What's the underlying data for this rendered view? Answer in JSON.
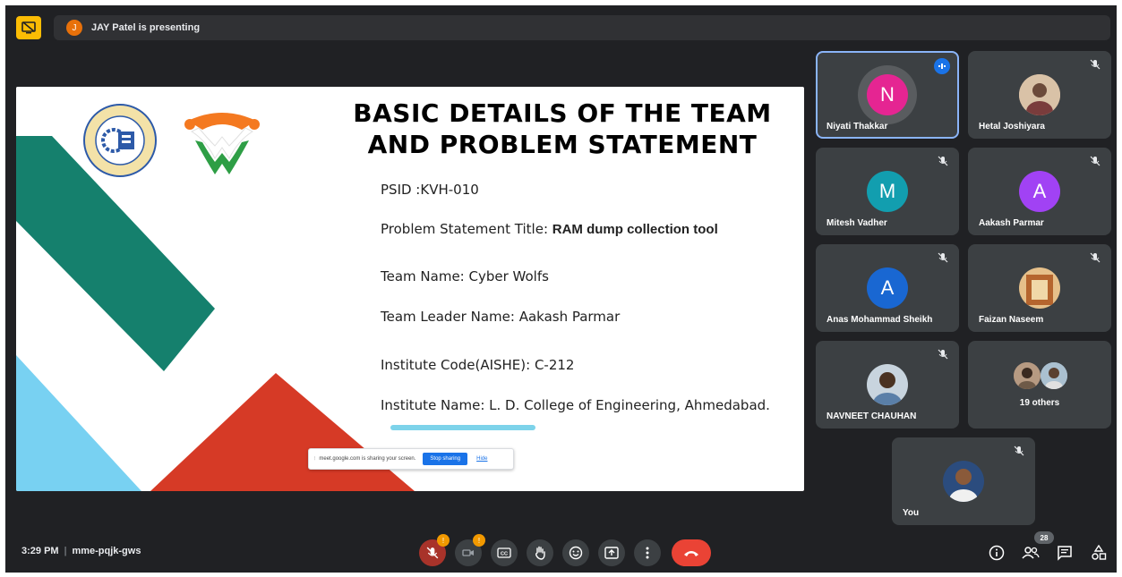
{
  "topbar": {
    "presenter_initial": "J",
    "presenting_text": "JAY Patel is presenting",
    "present_icon": "screen-share-off-icon"
  },
  "slide": {
    "title_line1": "BASIC DETAILS OF THE TEAM",
    "title_line2": "AND PROBLEM STATEMENT",
    "psid": "PSID :KVH-010",
    "problem_label": "Problem Statement Title: ",
    "problem_value": "RAM dump collection tool",
    "team_name": "Team Name: Cyber Wolfs",
    "team_leader": "Team Leader Name:  Aakash Parmar",
    "institute_code": "Institute Code(AISHE): C-212",
    "institute_name": "Institute Name:  L. D. College of Engineering, Ahmedabad.",
    "logo1_text": "L.D. COLLEGE OF ENGINEERING AHMEDABAD",
    "logo2_name": "sih-logo"
  },
  "share_bar": {
    "message": "meet.google.com is sharing your screen.",
    "stop_label": "Stop sharing",
    "hide_label": "Hide"
  },
  "participants": [
    {
      "name": "Niyati Thakkar",
      "initial": "N",
      "color": "#e52592",
      "speaking": true
    },
    {
      "name": "Hetal Joshiyara",
      "initial": "",
      "color": "#c9a48a",
      "muted": true
    },
    {
      "name": "Mitesh Vadher",
      "initial": "M",
      "color": "#129eaf",
      "muted": true
    },
    {
      "name": "Aakash Parmar",
      "initial": "A",
      "color": "#a142f4",
      "muted": true
    },
    {
      "name": "Anas Mohammad Sheikh",
      "initial": "A",
      "color": "#1967d2",
      "muted": true
    },
    {
      "name": "Faizan Naseem",
      "initial": "",
      "color": "#d9b07a",
      "muted": true
    },
    {
      "name": "NAVNEET CHAUHAN",
      "initial": "",
      "color": "#a8b8c8",
      "muted": true
    },
    {
      "name": "19 others",
      "initial": "",
      "color": "#8d6e63"
    },
    {
      "name": "You",
      "initial": "",
      "color": "#2b4c7e",
      "muted": true
    }
  ],
  "bottom": {
    "time": "3:29 PM",
    "separator": "|",
    "meeting_code": "mme-pqjk-gws",
    "mic_badge": "!",
    "cam_badge": "!",
    "people_count": "28"
  },
  "colors": {
    "background": "#202124",
    "tile": "#3c4043",
    "accent": "#8ab4f8",
    "danger": "#ea4335"
  }
}
